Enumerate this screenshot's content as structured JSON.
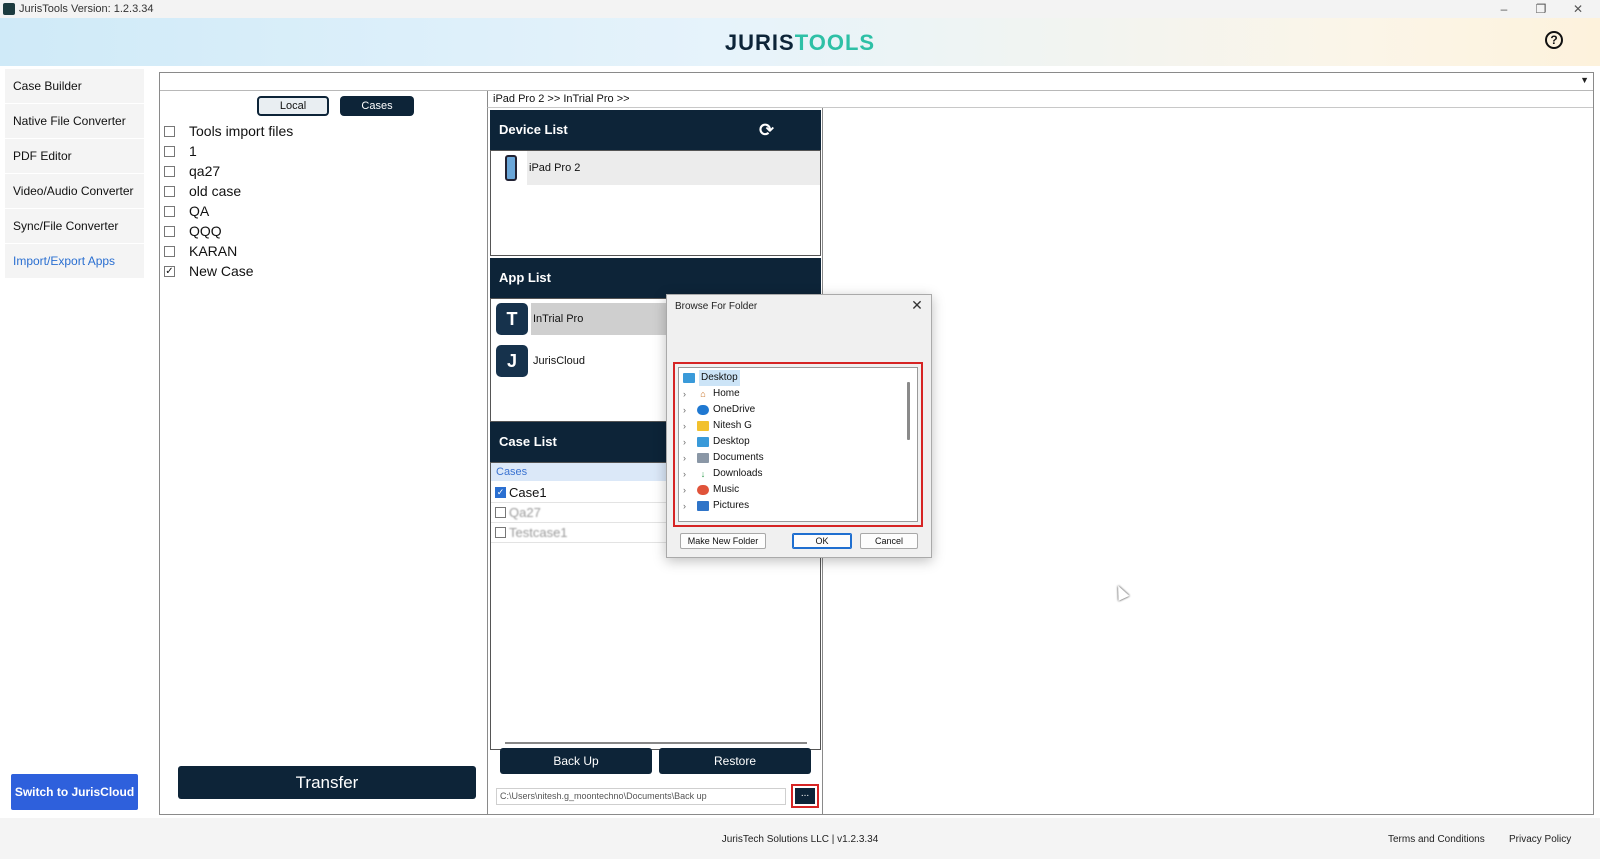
{
  "window": {
    "title": "JurisTools  Version: 1.2.3.34",
    "controls": [
      "minimize",
      "restore",
      "close"
    ]
  },
  "header": {
    "logo_part1": "JURIS",
    "logo_part2": "TOOLS",
    "help_icon": "question-circle-icon"
  },
  "sidebar": {
    "items": [
      {
        "label": "Case Builder",
        "active": false
      },
      {
        "label": "Native File Converter",
        "active": false
      },
      {
        "label": "PDF Editor",
        "active": false
      },
      {
        "label": "Video/Audio Converter",
        "active": false
      },
      {
        "label": "Sync/File Converter",
        "active": false
      },
      {
        "label": "Import/Export Apps",
        "active": true
      }
    ],
    "switch_label": "Switch to JurisCloud"
  },
  "cases_panel": {
    "tabs": [
      {
        "label": "Local",
        "active": false
      },
      {
        "label": "Cases",
        "active": true
      }
    ],
    "items": [
      {
        "label": "Tools import files",
        "checked": false
      },
      {
        "label": "1",
        "checked": false
      },
      {
        "label": "qa27",
        "checked": false
      },
      {
        "label": "old case",
        "checked": false
      },
      {
        "label": "QA",
        "checked": false
      },
      {
        "label": "QQQ",
        "checked": false
      },
      {
        "label": "KARAN",
        "checked": false
      },
      {
        "label": "New Case",
        "checked": true
      }
    ],
    "transfer_label": "Transfer"
  },
  "breadcrumb": "iPad Pro 2 >>  InTrial Pro >>",
  "device_list": {
    "title": "Device List",
    "refresh_icon": "refresh-icon",
    "devices": [
      {
        "label": "iPad Pro 2"
      }
    ]
  },
  "app_list": {
    "title": "App List",
    "apps": [
      {
        "label": "InTrial Pro",
        "icon": "intrial-pro-app-icon",
        "selected": true
      },
      {
        "label": "JurisCloud",
        "icon": "juriscloud-app-icon",
        "selected": false
      }
    ]
  },
  "case_list": {
    "title": "Case List",
    "subheader": "Cases",
    "items": [
      {
        "label": "Case1",
        "checked": true
      },
      {
        "label": "Qa27",
        "checked": false
      },
      {
        "label": "Testcase1",
        "checked": false
      }
    ]
  },
  "backup": {
    "backup_label": "Back Up",
    "restore_label": "Restore",
    "path_value": "C:\\Users\\nitesh.g_moontechno\\Documents\\Back up",
    "browse_label": "..."
  },
  "dialog": {
    "title": "Browse For Folder",
    "tree": [
      {
        "label": "Desktop",
        "icon": "desktop-folder-icon",
        "root": true
      },
      {
        "label": "Home",
        "icon": "home-icon"
      },
      {
        "label": "OneDrive",
        "icon": "cloud-icon"
      },
      {
        "label": "Nitesh G",
        "icon": "folder-icon"
      },
      {
        "label": "Desktop",
        "icon": "desktop-folder-icon"
      },
      {
        "label": "Documents",
        "icon": "documents-icon"
      },
      {
        "label": "Downloads",
        "icon": "download-icon"
      },
      {
        "label": "Music",
        "icon": "music-icon"
      },
      {
        "label": "Pictures",
        "icon": "pictures-icon"
      }
    ],
    "make_folder_label": "Make New Folder",
    "ok_label": "OK",
    "cancel_label": "Cancel"
  },
  "footer": {
    "center_text": "JurisTech Solutions LLC | v1.2.3.34",
    "terms_label": "Terms and Conditions",
    "privacy_label": "Privacy Policy"
  },
  "colors": {
    "navy": "#0d2438",
    "teal": "#2ec0a6",
    "accent_blue": "#2e60dc",
    "highlight_red": "#d62424"
  }
}
